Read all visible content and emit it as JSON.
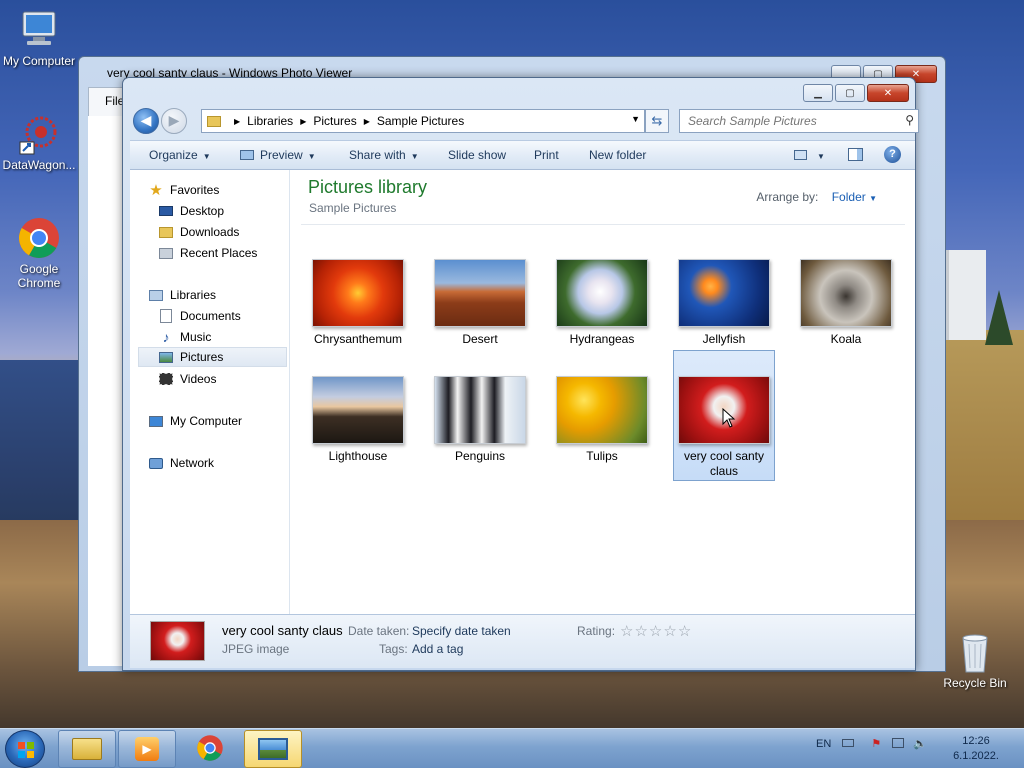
{
  "desktop": {
    "icons": [
      {
        "label": "My Computer"
      },
      {
        "label": "DataWagon..."
      },
      {
        "label": "Google Chrome"
      },
      {
        "label": "Recycle Bin"
      }
    ]
  },
  "photo_viewer": {
    "title": "very cool santy claus - Windows Photo Viewer",
    "menu_file": "File"
  },
  "explorer": {
    "window_buttons": {
      "minimize": "▁",
      "maximize": "▢",
      "close": "✕"
    },
    "breadcrumb": [
      "Libraries",
      "Pictures",
      "Sample Pictures"
    ],
    "search_placeholder": "Search Sample Pictures",
    "toolbar": {
      "organize": "Organize",
      "preview": "Preview",
      "share_with": "Share with",
      "slide_show": "Slide show",
      "print": "Print",
      "new_folder": "New folder"
    },
    "nav": {
      "favorites": "Favorites",
      "desktop": "Desktop",
      "downloads": "Downloads",
      "recent_places": "Recent Places",
      "libraries": "Libraries",
      "documents": "Documents",
      "music": "Music",
      "pictures": "Pictures",
      "videos": "Videos",
      "my_computer": "My Computer",
      "network": "Network"
    },
    "library_title": "Pictures library",
    "library_subtitle": "Sample Pictures",
    "arrange_label": "Arrange by:",
    "arrange_value": "Folder",
    "files": [
      {
        "name": "Chrysanthemum"
      },
      {
        "name": "Desert"
      },
      {
        "name": "Hydrangeas"
      },
      {
        "name": "Jellyfish"
      },
      {
        "name": "Koala"
      },
      {
        "name": "Lighthouse"
      },
      {
        "name": "Penguins"
      },
      {
        "name": "Tulips"
      },
      {
        "name": "very cool santy claus",
        "selected": true
      }
    ],
    "details": {
      "name": "very cool santy claus",
      "type": "JPEG image",
      "date_taken_label": "Date taken:",
      "date_taken_value": "Specify date taken",
      "tags_label": "Tags:",
      "tags_value": "Add a tag",
      "rating_label": "Rating:",
      "rating_stars": 0
    }
  },
  "taskbar": {
    "language": "EN",
    "time": "12:26",
    "date": "6.1.2022."
  }
}
